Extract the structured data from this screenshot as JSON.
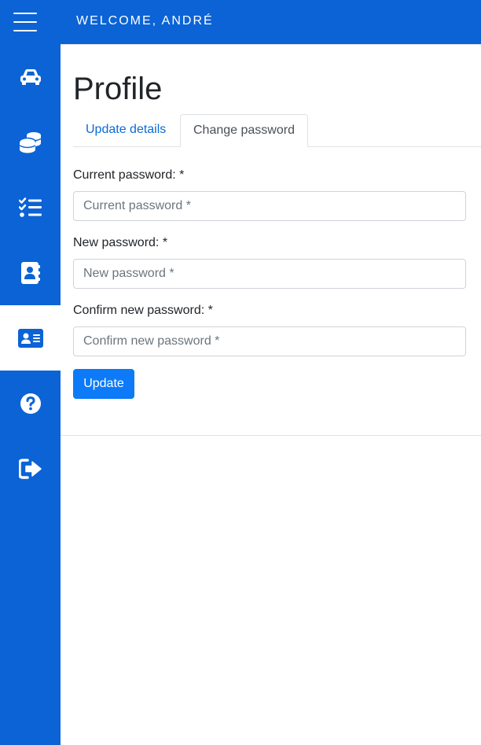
{
  "header": {
    "welcome_text": "WELCOME, ANDRÉ",
    "menu_icon": "hamburger-menu-icon"
  },
  "colors": {
    "primary": "#0b63d6",
    "link": "#0b6bd6",
    "button": "#0d7af7"
  },
  "sidebar": {
    "items": [
      {
        "icon": "car-icon",
        "active": false
      },
      {
        "icon": "coins-icon",
        "active": false
      },
      {
        "icon": "tasks-icon",
        "active": false
      },
      {
        "icon": "address-book-icon",
        "active": false
      },
      {
        "icon": "id-card-icon",
        "active": true
      },
      {
        "icon": "question-circle-icon",
        "active": false
      },
      {
        "icon": "sign-out-icon",
        "active": false
      }
    ]
  },
  "main": {
    "title": "Profile",
    "tabs": [
      {
        "label": "Update details",
        "active": false
      },
      {
        "label": "Change password",
        "active": true
      }
    ],
    "form": {
      "current_password": {
        "label": "Current password: *",
        "placeholder": "Current password *",
        "value": ""
      },
      "new_password": {
        "label": "New password: *",
        "placeholder": "New password *",
        "value": ""
      },
      "confirm_password": {
        "label": "Confirm new password: *",
        "placeholder": "Confirm new password *",
        "value": ""
      },
      "submit_label": "Update"
    }
  }
}
